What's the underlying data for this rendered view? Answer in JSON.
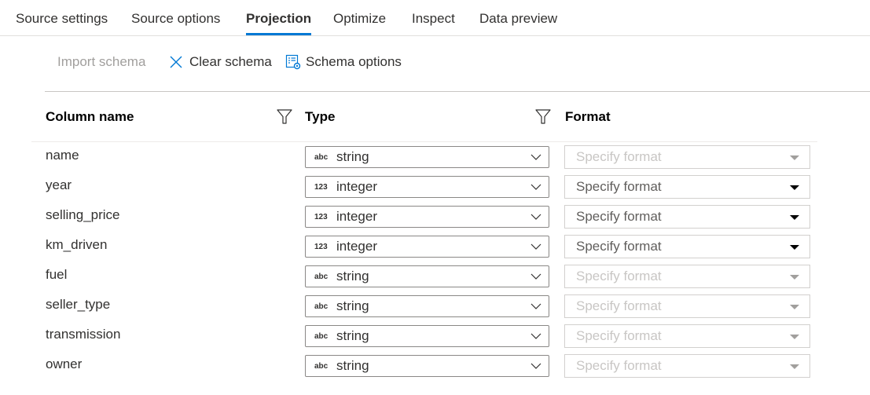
{
  "tabs": [
    {
      "label": "Source settings",
      "active": false
    },
    {
      "label": "Source options",
      "active": false
    },
    {
      "label": "Projection",
      "active": true
    },
    {
      "label": "Optimize",
      "active": false
    },
    {
      "label": "Inspect",
      "active": false
    },
    {
      "label": "Data preview",
      "active": false
    }
  ],
  "toolbar": {
    "import_schema": "Import schema",
    "clear_schema": "Clear schema",
    "schema_options": "Schema options",
    "accent_color": "#0078d4"
  },
  "table": {
    "headers": {
      "column_name": "Column name",
      "type": "Type",
      "format": "Format"
    },
    "rows": [
      {
        "name": "name",
        "type_icon": "abc",
        "type": "string",
        "format_placeholder": "Specify format",
        "format_enabled": false
      },
      {
        "name": "year",
        "type_icon": "123",
        "type": "integer",
        "format_placeholder": "Specify format",
        "format_enabled": true
      },
      {
        "name": "selling_price",
        "type_icon": "123",
        "type": "integer",
        "format_placeholder": "Specify format",
        "format_enabled": true
      },
      {
        "name": "km_driven",
        "type_icon": "123",
        "type": "integer",
        "format_placeholder": "Specify format",
        "format_enabled": true
      },
      {
        "name": "fuel",
        "type_icon": "abc",
        "type": "string",
        "format_placeholder": "Specify format",
        "format_enabled": false
      },
      {
        "name": "seller_type",
        "type_icon": "abc",
        "type": "string",
        "format_placeholder": "Specify format",
        "format_enabled": false
      },
      {
        "name": "transmission",
        "type_icon": "abc",
        "type": "string",
        "format_placeholder": "Specify format",
        "format_enabled": false
      },
      {
        "name": "owner",
        "type_icon": "abc",
        "type": "string",
        "format_placeholder": "Specify format",
        "format_enabled": false
      }
    ]
  }
}
